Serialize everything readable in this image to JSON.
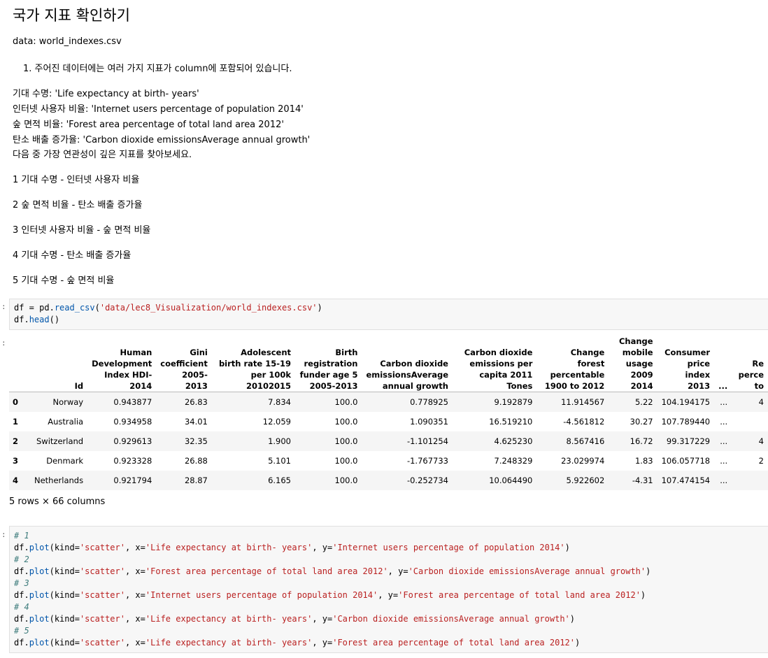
{
  "title": "국가 지표 확인하기",
  "data_line": "data: world_indexes.csv",
  "question": "1. 주어진 데이터에는 여러 가지 지표가 column에 포함되어 있습니다.",
  "definitions": [
    "기대 수명: 'Life expectancy at birth- years'",
    "인터넷 사용자 비율: 'Internet users percentage of population 2014'",
    "숲 면적 비율: 'Forest area percentage of total land area 2012'",
    "탄소 배출 증가율: 'Carbon dioxide emissionsAverage annual growth'",
    "다음 중 가장 연관성이 깊은 지표를 찾아보세요."
  ],
  "options": [
    "1 기대 수명 - 인터넷 사용자 비율",
    "2 숲 면적 비율 - 탄소 배출 증가율",
    "3 인터넷 사용자 비율 - 숲 면적 비율",
    "4 기대 수명 - 탄소 배출 증가율",
    "5 기대 수명 - 숲 면적 비율"
  ],
  "prompt_char": ":",
  "code1": {
    "line1_var": "df",
    "line1_eq": " = ",
    "line1_mod": "pd.",
    "line1_fn": "read_csv",
    "line1_str": "'data/lec8_Visualization/world_indexes.csv'",
    "line2_var": "df.",
    "line2_fn": "head",
    "line2_end": "()"
  },
  "table": {
    "headers": [
      "Id",
      "Human Development Index HDI-2014",
      "Gini coefficient 2005-2013",
      "Adolescent birth rate 15-19 per 100k 20102015",
      "Birth registration funder age 5 2005-2013",
      "Carbon dioxide emissionsAverage annual growth",
      "Carbon dioxide emissions per capita 2011 Tones",
      "Change forest percentable 1900 to 2012",
      "Change mobile usage 2009 2014",
      "Consumer price index 2013",
      "...",
      "Re perce to"
    ],
    "rows": [
      {
        "idx": "0",
        "cells": [
          "Norway",
          "0.943877",
          "26.83",
          "7.834",
          "100.0",
          "0.778925",
          "9.192879",
          "11.914567",
          "5.22",
          "104.194175",
          "...",
          "4"
        ]
      },
      {
        "idx": "1",
        "cells": [
          "Australia",
          "0.934958",
          "34.01",
          "12.059",
          "100.0",
          "1.090351",
          "16.519210",
          "-4.561812",
          "30.27",
          "107.789440",
          "...",
          ""
        ]
      },
      {
        "idx": "2",
        "cells": [
          "Switzerland",
          "0.929613",
          "32.35",
          "1.900",
          "100.0",
          "-1.101254",
          "4.625230",
          "8.567416",
          "16.72",
          "99.317229",
          "...",
          "4"
        ]
      },
      {
        "idx": "3",
        "cells": [
          "Denmark",
          "0.923328",
          "26.88",
          "5.101",
          "100.0",
          "-1.767733",
          "7.248329",
          "23.029974",
          "1.83",
          "106.057718",
          "...",
          "2"
        ]
      },
      {
        "idx": "4",
        "cells": [
          "Netherlands",
          "0.921794",
          "28.87",
          "6.165",
          "100.0",
          "-0.252734",
          "10.064490",
          "5.922602",
          "-4.31",
          "107.474154",
          "...",
          ""
        ]
      }
    ],
    "shape": "5 rows × 66 columns"
  },
  "code2": [
    {
      "type": "comment",
      "text": "# 1"
    },
    {
      "type": "plot",
      "x": "'Life expectancy at birth- years'",
      "y": "'Internet users percentage of population 2014'"
    },
    {
      "type": "comment",
      "text": "# 2"
    },
    {
      "type": "plot",
      "x": "'Forest area percentage of total land area 2012'",
      "y": "'Carbon dioxide emissionsAverage annual growth'"
    },
    {
      "type": "comment",
      "text": "# 3"
    },
    {
      "type": "plot",
      "x": "'Internet users percentage of population 2014'",
      "y": "'Forest area percentage of total land area 2012'"
    },
    {
      "type": "comment",
      "text": "# 4"
    },
    {
      "type": "plot",
      "x": "'Life expectancy at birth- years'",
      "y": "'Carbon dioxide emissionsAverage annual growth'"
    },
    {
      "type": "comment",
      "text": "# 5"
    },
    {
      "type": "plot",
      "x": "'Life expectancy at birth- years'",
      "y": "'Forest area percentage of total land area 2012'"
    }
  ],
  "plot_tokens": {
    "obj": "df.",
    "fn": "plot",
    "open": "(kind=",
    "kind": "'scatter'",
    "xeq": ", x=",
    "yeq": ", y=",
    "close": ")"
  }
}
